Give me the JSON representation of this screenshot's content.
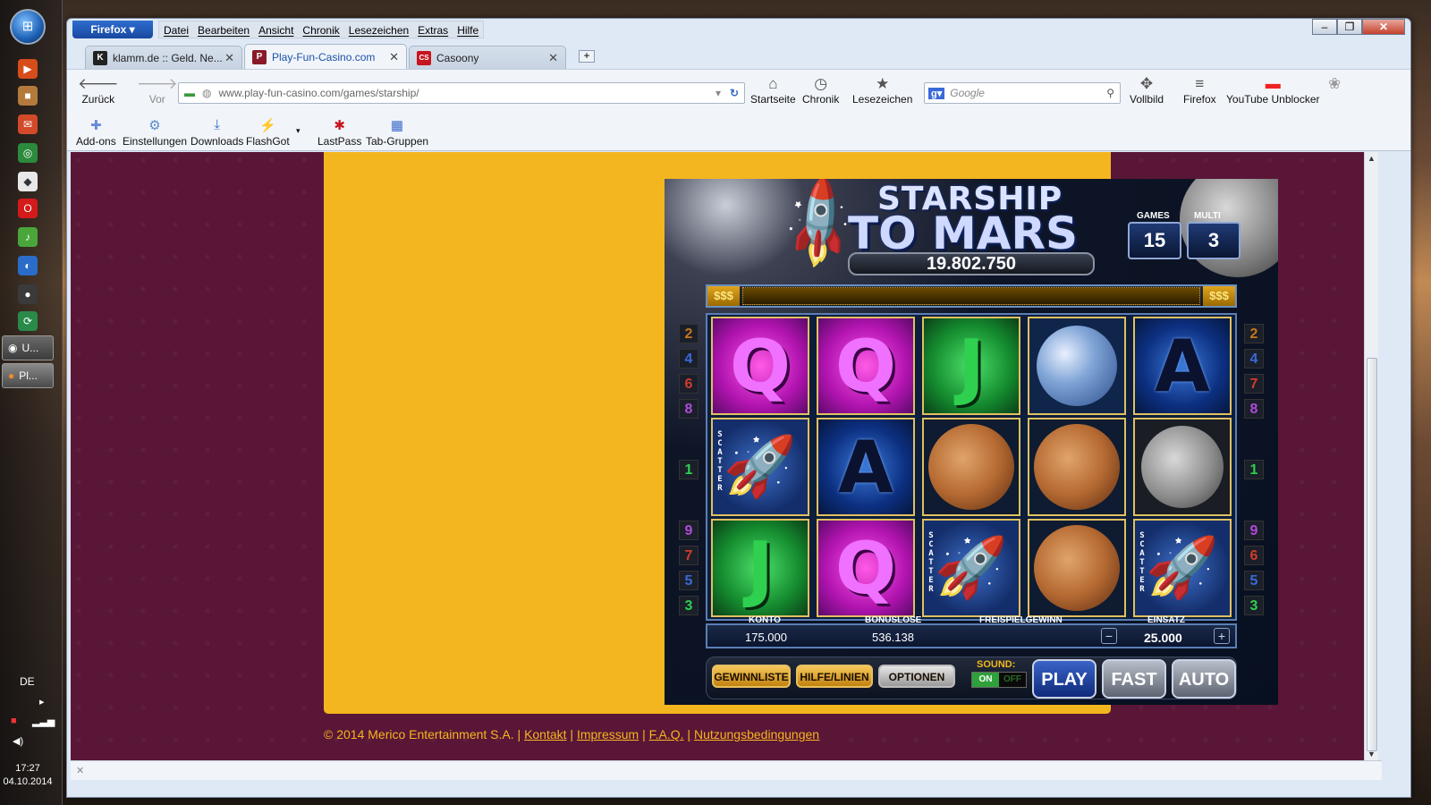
{
  "taskbar": {
    "tasks": [
      {
        "label": "U...",
        "icon": "app-icon"
      },
      {
        "label": "Pl...",
        "icon": "firefox-icon"
      }
    ],
    "language": "DE",
    "time": "17:27",
    "date": "04.10.2014"
  },
  "browser": {
    "firefox_button": "Firefox",
    "menu": [
      "Datei",
      "Bearbeiten",
      "Ansicht",
      "Chronik",
      "Lesezeichen",
      "Extras",
      "Hilfe"
    ],
    "tabs": [
      {
        "label": "klamm.de :: Geld. Ne...",
        "active": false,
        "favicon": "K"
      },
      {
        "label": "Play-Fun-Casino.com",
        "active": true,
        "favicon": "P"
      },
      {
        "label": "Casoony",
        "active": false,
        "favicon": "CS"
      }
    ],
    "nav": {
      "back": "Zurück",
      "forward": "Vor"
    },
    "url": "www.play-fun-casino.com/games/starship/",
    "nav_right": [
      "Startseite",
      "Chronik",
      "Lesezeichen"
    ],
    "search_placeholder": "Google",
    "nav_extra": [
      "Vollbild",
      "Firefox",
      "YouTube Unblocker"
    ],
    "bookmarks": [
      "Add-ons",
      "Einstellungen",
      "Downloads",
      "FlashGot",
      "LastPass",
      "Tab-Gruppen"
    ]
  },
  "game": {
    "title_line1": "STARSHIP",
    "title_line2": "TO MARS",
    "jackpot": "19.802.750",
    "games_label": "GAMES",
    "games_value": "15",
    "multi_label": "MULTI",
    "multi_value": "3",
    "dollar_left": "$$$",
    "dollar_right": "$$$",
    "reels": [
      [
        "Q",
        "scatter",
        "J"
      ],
      [
        "Q",
        "A",
        "Q"
      ],
      [
        "J",
        "mars",
        "scatter"
      ],
      [
        "earth",
        "mars",
        "mars"
      ],
      [
        "A",
        "moon",
        "scatter"
      ]
    ],
    "scatter_text": "SCATTER",
    "left_lines": [
      "2",
      "4",
      "6",
      "8",
      "1",
      "9",
      "7",
      "5",
      "3"
    ],
    "right_lines": [
      "2",
      "4",
      "7",
      "8",
      "1",
      "9",
      "6",
      "5",
      "3"
    ],
    "konto_label": "KONTO",
    "konto_value": "175.000",
    "bonus_label": "BONUSLOSE",
    "bonus_value": "536.138",
    "freispiel_label": "FREISPIELGEWINN",
    "einsatz_label": "EINSATZ",
    "einsatz_value": "25.000",
    "btn_gewinnliste": "GEWINNLISTE",
    "btn_hilfe": "HILFE/LINIEN",
    "btn_optionen": "OPTIONEN",
    "sound_label": "SOUND:",
    "sound_on": "ON",
    "sound_off": "OFF",
    "btn_play": "PLAY",
    "btn_fast": "FAST",
    "btn_auto": "AUTO"
  },
  "footer": {
    "copyright": "© 2014 Merico Entertainment S.A.",
    "links": [
      "Kontakt",
      "Impressum",
      "F.A.Q.",
      "Nutzungsbedingungen"
    ]
  },
  "colors": {
    "accent": "#f4b61e",
    "page_bg": "#5a1636"
  }
}
